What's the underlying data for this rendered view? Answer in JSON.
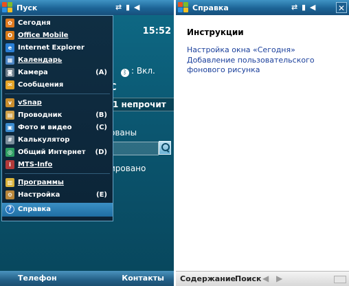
{
  "left_screen": {
    "start_title": "Пуск",
    "status_icons": "⇄ ▮ ◀",
    "clock": "15:52",
    "today": {
      "bluetooth_label": ": Вкл.",
      "row_c": "С",
      "row_unread": "1 непрочит",
      "row_scheduled": "ованы",
      "row_synced": "ировано"
    },
    "menu_items": [
      {
        "label": "Сегодня",
        "shortcut": "",
        "icon": "today-icon",
        "color": "#e07a1f",
        "glyph": "✿",
        "underline": false
      },
      {
        "label": "Office Mobile",
        "shortcut": "",
        "icon": "office-mobile-icon",
        "color": "#d97a18",
        "glyph": "O",
        "underline": true
      },
      {
        "label": "Internet Explorer",
        "shortcut": "",
        "icon": "internet-explorer-icon",
        "color": "#2a7fd4",
        "glyph": "e",
        "underline": false
      },
      {
        "label": "Календарь",
        "shortcut": "",
        "icon": "calendar-icon",
        "color": "#4d86c4",
        "glyph": "▦",
        "underline": true
      },
      {
        "label": "Камера",
        "shortcut": "(A)",
        "icon": "camera-icon",
        "color": "#6d7d8a",
        "glyph": "◙",
        "underline": false
      },
      {
        "label": "Сообщения",
        "shortcut": "",
        "icon": "messages-icon",
        "color": "#e4a325",
        "glyph": "✉",
        "underline": false
      },
      {
        "label": "vSnap",
        "shortcut": "",
        "icon": "vsnap-icon",
        "color": "#c98d2d",
        "glyph": "v",
        "underline": true
      },
      {
        "label": "Проводник",
        "shortcut": "(B)",
        "icon": "explorer-icon",
        "color": "#d1a24a",
        "glyph": "▤",
        "underline": false
      },
      {
        "label": "Фото и видео",
        "shortcut": "(C)",
        "icon": "photo-video-icon",
        "color": "#3b8ccf",
        "glyph": "▣",
        "underline": false
      },
      {
        "label": "Калькулятор",
        "shortcut": "",
        "icon": "calculator-icon",
        "color": "#7c8f9c",
        "glyph": "#",
        "underline": false
      },
      {
        "label": "Общий Интернет",
        "shortcut": "(D)",
        "icon": "internet-sharing-icon",
        "color": "#2f9f63",
        "glyph": "◎",
        "underline": false
      },
      {
        "label": "MTS-Info",
        "shortcut": "",
        "icon": "mts-info-icon",
        "color": "#b23a3a",
        "glyph": "i",
        "underline": true
      },
      {
        "label": "Программы",
        "shortcut": "",
        "icon": "programs-icon",
        "color": "#d9b23a",
        "glyph": "▥",
        "underline": true
      },
      {
        "label": "Настройка",
        "shortcut": "(E)",
        "icon": "settings-icon",
        "color": "#b8863a",
        "glyph": "⚙",
        "underline": false
      },
      {
        "label": "Справка",
        "shortcut": "",
        "icon": "help-icon",
        "color": "#2a78c4",
        "glyph": "?",
        "underline": false,
        "selected": true
      }
    ],
    "softkeys": {
      "left": "Телефон",
      "right": "Контакты"
    }
  },
  "right_screen": {
    "title": "Справка",
    "status_icons": "⇄ ▮ ◀",
    "close_label": "✕",
    "heading": "Инструкции",
    "links": [
      "Настройка окна «Сегодня»",
      "Добавление пользовательского",
      "фонового рисунка"
    ],
    "toolbar": {
      "contents": "Содержание",
      "search": "Поиск",
      "back": "◀",
      "forward": "▶"
    }
  },
  "colors": {
    "today_bg": "#0b5670",
    "menu_bg": "#0f2e43",
    "selection": "#2f80b8",
    "titlebar": "#1c6496",
    "link": "#1a3f9b"
  }
}
